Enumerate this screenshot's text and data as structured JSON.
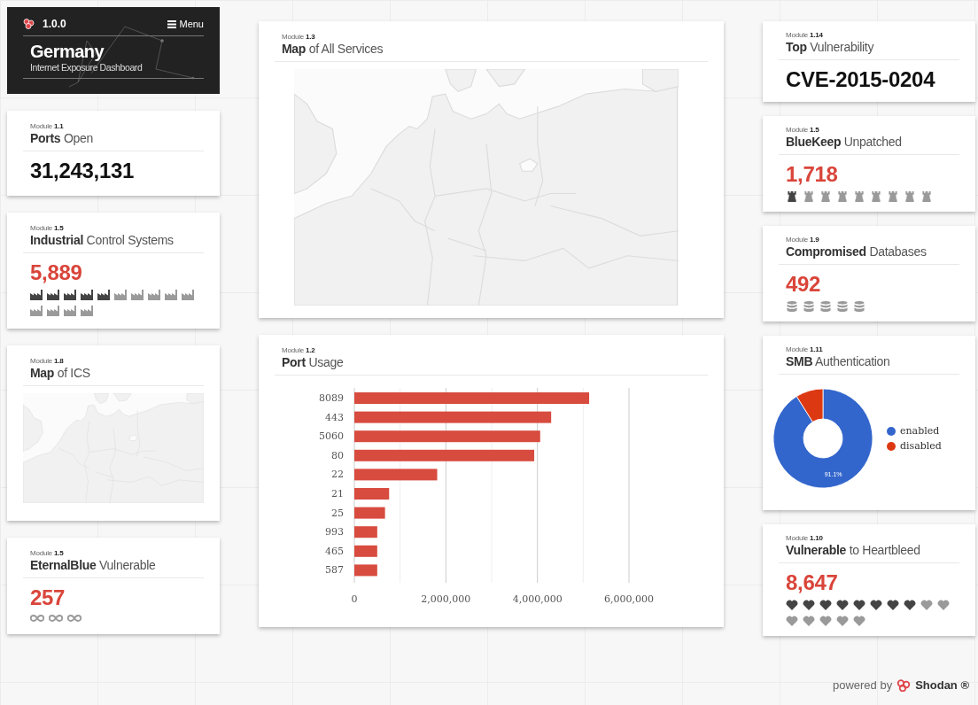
{
  "header": {
    "version": "1.0.0",
    "menu": "Menu",
    "country": "Germany",
    "subtitle": "Internet Exposure Dashboard"
  },
  "columns": [
    {
      "cards": [
        {
          "kind": "stat",
          "module": "Module **1.1**",
          "title": "**Ports** Open",
          "value": "31,243,131",
          "alert": false
        },
        {
          "kind": "factory",
          "module": "Module **1.5**",
          "title": "**Industrial** Control Systems",
          "value": "5,889",
          "alert": true,
          "icons": [
            {
              "filled": true
            },
            {
              "filled": true
            },
            {
              "filled": true
            },
            {
              "filled": true
            },
            {
              "filled": true
            },
            {
              "filled": false
            },
            {
              "filled": false
            },
            {
              "filled": false
            },
            {
              "filled": false
            },
            {
              "filled": false
            },
            {
              "filled": false
            },
            {
              "filled": false
            },
            {
              "filled": false
            },
            {
              "filled": false
            }
          ]
        },
        {
          "kind": "map",
          "module": "Module **1.8**",
          "title": "**Map** of ICS"
        },
        {
          "kind": "link",
          "module": "Module **1.5**",
          "title": "**EternalBlue** Vulnerable",
          "value": "257",
          "alert": true,
          "icons": [
            {
              "filled": false
            },
            {
              "filled": false
            },
            {
              "filled": false
            }
          ]
        }
      ]
    },
    {
      "cards": [
        {
          "kind": "map",
          "module": "Module **1.3**",
          "title": "**Map** of All Services"
        },
        {
          "kind": "chart",
          "module": "Module **1.2**",
          "title": "**Port** Usage",
          "chart_data": {
            "type": "bar",
            "orientation": "horizontal",
            "categories": [
              "8089",
              "443",
              "5060",
              "80",
              "22",
              "21",
              "25",
              "993",
              "465",
              "587"
            ],
            "series": [
              {
                "color": "#d84b3f",
                "values": [
                  5130000,
                  4300000,
                  4060000,
                  3930000,
                  1810000,
                  760000,
                  670000,
                  500000,
                  500000,
                  500000
                ]
              }
            ],
            "xlim": [
              0,
              6000000
            ],
            "xticks": [
              {
                "value": 0,
                "label": "0"
              },
              {
                "value": 2000000,
                "label": "2,000,000"
              },
              {
                "value": 4000000,
                "label": "4,000,000"
              },
              {
                "value": 6000000,
                "label": "6,000,000"
              }
            ]
          }
        }
      ]
    },
    {
      "cards": [
        {
          "kind": "stat",
          "module": "Module **1.14**",
          "title": "**Top** Vulnerability",
          "value": "CVE-2015-0204",
          "alert": false
        },
        {
          "kind": "tower",
          "module": "Module **1.5**",
          "title": "**BlueKeep** Unpatched",
          "value": "1,718",
          "alert": true,
          "icons": [
            {
              "filled": true
            },
            {
              "filled": false
            },
            {
              "filled": false
            },
            {
              "filled": false
            },
            {
              "filled": false
            },
            {
              "filled": false
            },
            {
              "filled": false
            },
            {
              "filled": false
            },
            {
              "filled": false
            }
          ]
        },
        {
          "kind": "database",
          "module": "Module **1.9**",
          "title": "**Compromised** Databases",
          "value": "492",
          "alert": true,
          "icons": [
            {
              "filled": false
            },
            {
              "filled": false
            },
            {
              "filled": false
            },
            {
              "filled": false
            },
            {
              "filled": false
            }
          ]
        },
        {
          "kind": "donut",
          "module": "Module **1.11**",
          "title": "**SMB** Authentication",
          "chart_data": {
            "type": "donut",
            "categories": [
              "enabled",
              "disabled"
            ],
            "series": [
              {
                "colors": [
                  "#3366cc",
                  "#dc3912"
                ],
                "values": [
                  91.1,
                  8.9
                ]
              }
            ],
            "value_labels": [
              "91.1%"
            ]
          }
        },
        {
          "kind": "heart",
          "module": "Module **1.10**",
          "title": "**Vulnerable** to Heartbleed",
          "value": "8,647",
          "alert": true,
          "icons": [
            {
              "filled": true
            },
            {
              "filled": true
            },
            {
              "filled": true
            },
            {
              "filled": true
            },
            {
              "filled": true
            },
            {
              "filled": true
            },
            {
              "filled": true
            },
            {
              "filled": true
            },
            {
              "filled": false
            },
            {
              "filled": false
            },
            {
              "filled": false
            },
            {
              "filled": false
            },
            {
              "filled": false
            },
            {
              "filled": false
            },
            {
              "filled": false
            }
          ]
        }
      ]
    }
  ],
  "footer": {
    "powered": "powered by",
    "brand": "Shodan ®"
  }
}
